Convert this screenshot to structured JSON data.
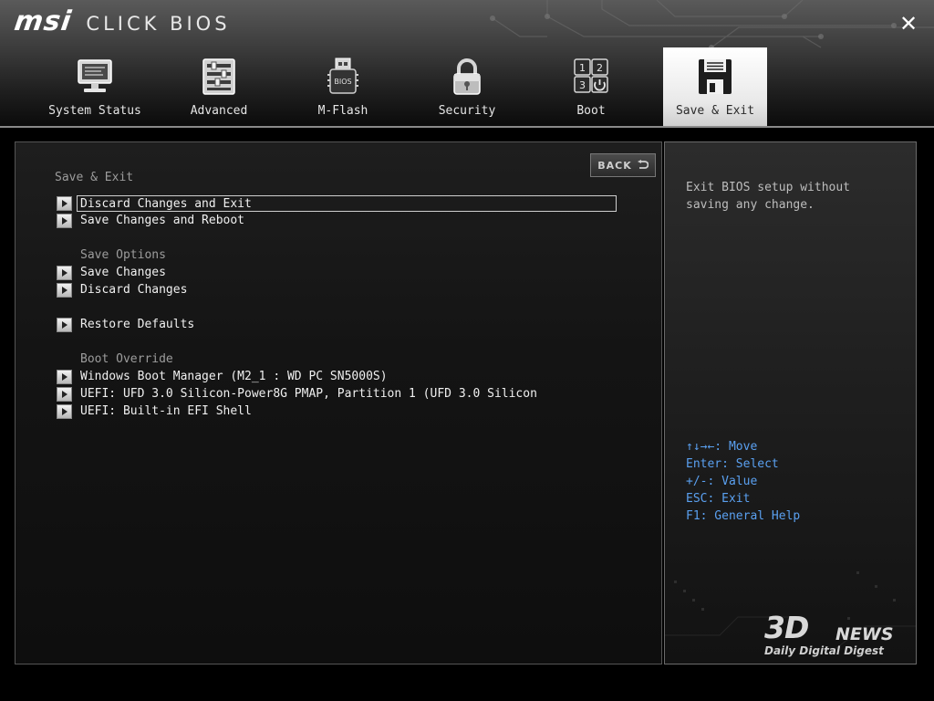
{
  "app": {
    "logo": "msi",
    "title": "CLICK BIOS",
    "close_icon": "close-icon"
  },
  "tabs": [
    {
      "label": "System Status",
      "icon": "monitor-icon",
      "active": false
    },
    {
      "label": "Advanced",
      "icon": "sliders-icon",
      "active": false
    },
    {
      "label": "M-Flash",
      "icon": "usb-flash-icon",
      "active": false
    },
    {
      "label": "Security",
      "icon": "padlock-icon",
      "active": false
    },
    {
      "label": "Boot",
      "icon": "boot-order-icon",
      "active": false
    },
    {
      "label": "Save & Exit",
      "icon": "floppy-disk-icon",
      "active": true
    }
  ],
  "bios_icon_text": "BIOS",
  "boot_icon_digits": [
    "1",
    "2",
    "3"
  ],
  "main": {
    "back_label": "BACK",
    "section_title": "Save & Exit",
    "items_top": [
      {
        "label": "Discard Changes and Exit",
        "selected": true
      },
      {
        "label": "Save Changes and Reboot",
        "selected": false
      }
    ],
    "save_options_title": "Save Options",
    "save_options": [
      {
        "label": "Save Changes"
      },
      {
        "label": "Discard Changes"
      }
    ],
    "restore_defaults": "Restore Defaults",
    "boot_override_title": "Boot Override",
    "boot_override": [
      {
        "label": "Windows Boot Manager (M2_1 : WD PC SN5000S)"
      },
      {
        "label": "UEFI: UFD 3.0 Silicon-Power8G PMAP, Partition 1 (UFD 3.0 Silicon"
      },
      {
        "label": "UEFI: Built-in EFI Shell"
      }
    ]
  },
  "help": {
    "line1": "Exit BIOS setup without",
    "line2": "saving any change.",
    "keys": [
      "↑↓→←: Move",
      "Enter: Select",
      "+/-: Value",
      "ESC: Exit",
      "F1: General Help"
    ]
  },
  "watermark": {
    "main": "3D",
    "news": "NEWS",
    "sub": "Daily Digital Digest"
  },
  "colors": {
    "accent_blue": "#5aa0f0",
    "text_main": "#f0f0f0",
    "text_dim": "#9c9c9c"
  }
}
